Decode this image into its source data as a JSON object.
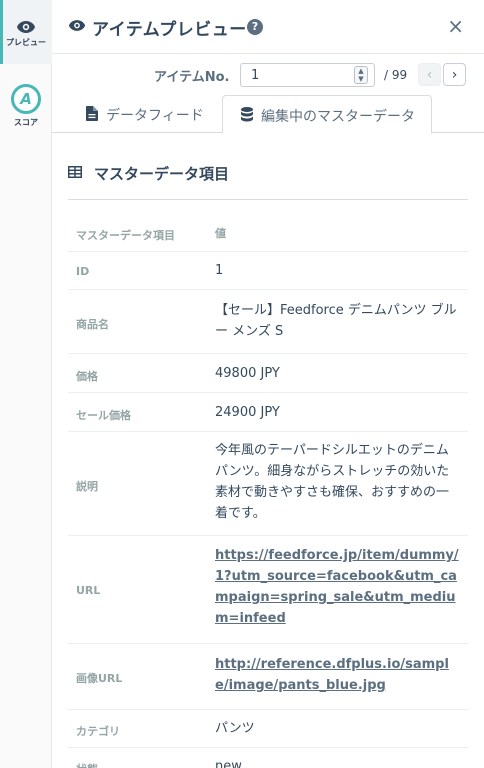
{
  "rail": {
    "preview_label": "プレビュー",
    "score_label": "スコア",
    "score_badge": "A"
  },
  "header": {
    "title": "アイテムプレビュー",
    "help": "?",
    "close": "×"
  },
  "item_nav": {
    "label": "アイテムNo.",
    "value": "1",
    "total": "/ 99",
    "prev": "‹",
    "next": "›"
  },
  "tabs": [
    {
      "label": "データフィード",
      "active": false
    },
    {
      "label": "編集中のマスターデータ",
      "active": true
    }
  ],
  "section": {
    "title": "マスターデータ項目"
  },
  "table": {
    "head": {
      "key": "マスターデータ項目",
      "value": "値"
    },
    "rows": [
      {
        "key": "ID",
        "value": "1"
      },
      {
        "key": "商品名",
        "value": "【セール】Feedforce デニムパンツ ブルー メンズ S"
      },
      {
        "key": "価格",
        "value": "49800 JPY"
      },
      {
        "key": "セール価格",
        "value": "24900 JPY"
      },
      {
        "key": "説明",
        "value": "今年風のテーパードシルエットのデニムパンツ。細身ながらストレッチの効いた素材で動きやすさも確保、おすすめの一着です。"
      },
      {
        "key": "URL",
        "value": "https://feedforce.jp/item/dummy/1?utm_source=facebook&utm_campaign=spring_sale&utm_medium=infeed"
      },
      {
        "key": "画像URL",
        "value": "http://reference.dfplus.io/sample/image/pants_blue.jpg"
      },
      {
        "key": "カテゴリ",
        "value": "パンツ"
      },
      {
        "key": "状態",
        "value": "new"
      }
    ]
  },
  "colors": {
    "accent": "#48b8b6",
    "text": "#34495e",
    "muted": "#95a5a6"
  }
}
